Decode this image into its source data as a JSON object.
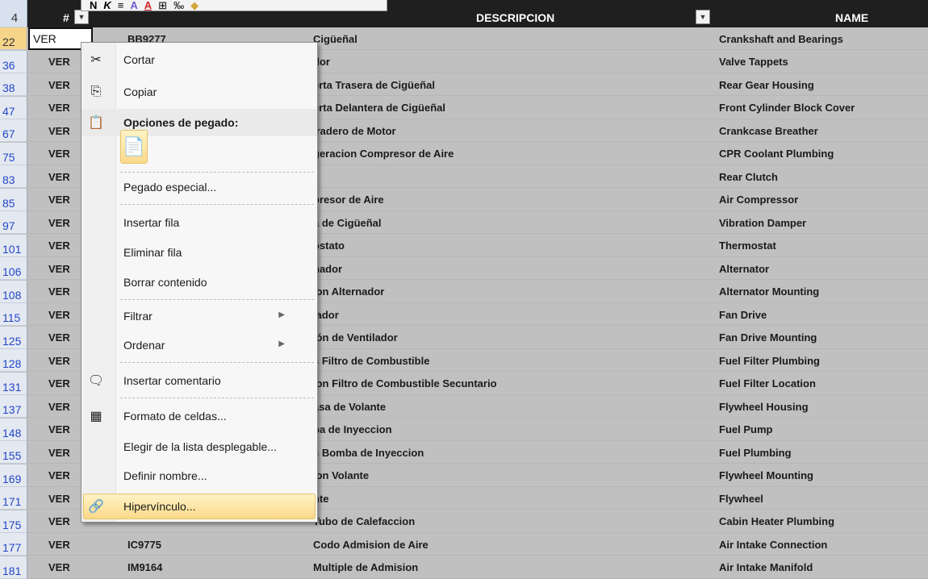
{
  "header": {
    "row_number": "4",
    "col_a": "#",
    "col_desc": "DESCRIPCION",
    "col_name": "NAME"
  },
  "active_cell_value": "VER",
  "rows": [
    {
      "n": "22",
      "a": "VER",
      "b": "BB9277",
      "d": "Cigüeñal",
      "e": "Crankshaft and Bearings"
    },
    {
      "n": "36",
      "a": "VER",
      "b": "",
      "d": "dor",
      "e": "Valve Tappets"
    },
    {
      "n": "38",
      "a": "VER",
      "b": "",
      "d": "erta Trasera de Cigüeñal",
      "e": "Rear Gear Housing"
    },
    {
      "n": "47",
      "a": "VER",
      "b": "",
      "d": "erta Delantera de Cigüeñal",
      "e": "Front Cylinder Block Cover"
    },
    {
      "n": "67",
      "a": "VER",
      "b": "",
      "d": "iradero de Motor",
      "e": "Crankcase Breather"
    },
    {
      "n": "75",
      "a": "VER",
      "b": "",
      "d": "geracion Compresor de Aire",
      "e": "CPR Coolant Plumbing"
    },
    {
      "n": "83",
      "a": "VER",
      "b": "",
      "d": "",
      "e": "Rear Clutch"
    },
    {
      "n": "85",
      "a": "VER",
      "b": "",
      "d": "presor de Aire",
      "e": "Air Compressor"
    },
    {
      "n": "97",
      "a": "VER",
      "b": "",
      "d": "a de Cigüeñal",
      "e": "Vibration Damper"
    },
    {
      "n": "101",
      "a": "VER",
      "b": "",
      "d": "ostato",
      "e": "Thermostat"
    },
    {
      "n": "106",
      "a": "VER",
      "b": "",
      "d": "nador",
      "e": "Alternator"
    },
    {
      "n": "108",
      "a": "VER",
      "b": "",
      "d": "ion Alternador",
      "e": "Alternator Mounting"
    },
    {
      "n": "115",
      "a": "VER",
      "b": "",
      "d": "lador",
      "e": "Fan Drive"
    },
    {
      "n": "125",
      "a": "VER",
      "b": "",
      "d": "ión de Ventilador",
      "e": "Fan Drive Mounting"
    },
    {
      "n": "128",
      "a": "VER",
      "b": "",
      "d": "s Filtro de Combustible",
      "e": "Fuel Filter Plumbing"
    },
    {
      "n": "131",
      "a": "VER",
      "b": "",
      "d": "ion Filtro de Combustible Secuntario",
      "e": "Fuel Filter Location"
    },
    {
      "n": "137",
      "a": "VER",
      "b": "",
      "d": "asa de Volante",
      "e": "Flywheel Housing"
    },
    {
      "n": "148",
      "a": "VER",
      "b": "",
      "d": "ba de Inyeccion",
      "e": "Fuel Pump"
    },
    {
      "n": "155",
      "a": "VER",
      "b": "",
      "d": "s Bomba de Inyeccion",
      "e": "Fuel Plumbing"
    },
    {
      "n": "169",
      "a": "VER",
      "b": "",
      "d": "ion Volante",
      "e": "Flywheel Mounting"
    },
    {
      "n": "171",
      "a": "VER",
      "b": "",
      "d": "nte",
      "e": "Flywheel"
    },
    {
      "n": "175",
      "a": "VER",
      "b": "",
      "d": "Tubo de Calefaccion",
      "e": "Cabin Heater Plumbing"
    },
    {
      "n": "177",
      "a": "VER",
      "b": "IC9775",
      "d": "Codo Admision de Aire",
      "e": "Air Intake Connection"
    },
    {
      "n": "181",
      "a": "VER",
      "b": "IM9164",
      "d": "Multiple de Admision",
      "e": "Air Intake Manifold"
    }
  ],
  "mini_toolbar": {
    "bold": "N",
    "italic": "K",
    "align": "≡",
    "fill": "A",
    "font_color": "A",
    "borders": "⊞",
    "decimals": "‰",
    "format": "◆"
  },
  "context_menu": {
    "cut": "Cortar",
    "copy": "Copiar",
    "paste_options": "Opciones de pegado:",
    "paste_special": "Pegado especial...",
    "insert_row": "Insertar fila",
    "delete_row": "Eliminar fila",
    "clear_contents": "Borrar contenido",
    "filter": "Filtrar",
    "sort": "Ordenar",
    "insert_comment": "Insertar comentario",
    "format_cells": "Formato de celdas...",
    "pick_from_list": "Elegir de la lista desplegable...",
    "define_name": "Definir nombre...",
    "hyperlink": "Hipervínculo..."
  },
  "colors": {
    "highlight": "#fbd98a",
    "row_header_text": "#2346c7",
    "grid_bg": "#c0c0c0"
  }
}
